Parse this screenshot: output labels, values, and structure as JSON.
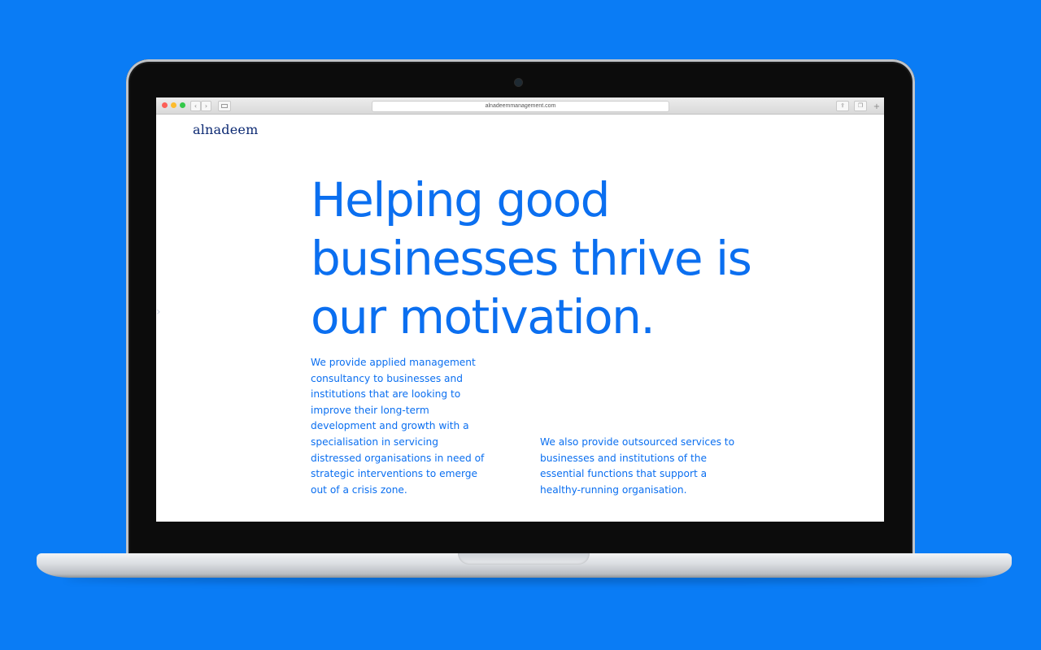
{
  "browser": {
    "url": "alnadeemmanagement.com",
    "back_glyph": "‹",
    "forward_glyph": "›",
    "share_glyph": "⇪",
    "tabs_glyph": "❐",
    "new_tab_glyph": "+",
    "icons": [
      "close-window-icon",
      "minimize-window-icon",
      "zoom-window-icon",
      "back-icon",
      "forward-icon",
      "sidebar-icon",
      "share-icon",
      "tabs-icon",
      "new-tab-icon"
    ]
  },
  "site": {
    "logo": "alnadeem",
    "side_arrow": "›",
    "headline": "Helping good businesses thrive is our motivation.",
    "intro_text": "We provide applied management consultancy to businesses and institutions that are looking  to improve their long-term development and growth with a specialisation in servicing distressed organisations in need of strategic interventions to emerge out of a crisis zone.",
    "services_text": "We also provide outsourced services to businesses and institutions of the essential functions that support a healthy-running organisation."
  },
  "colors": {
    "background": "#0a7cf5",
    "brand_blue": "#0b6ff0",
    "logo_navy": "#0d2a73",
    "screen": "#ffffff"
  }
}
